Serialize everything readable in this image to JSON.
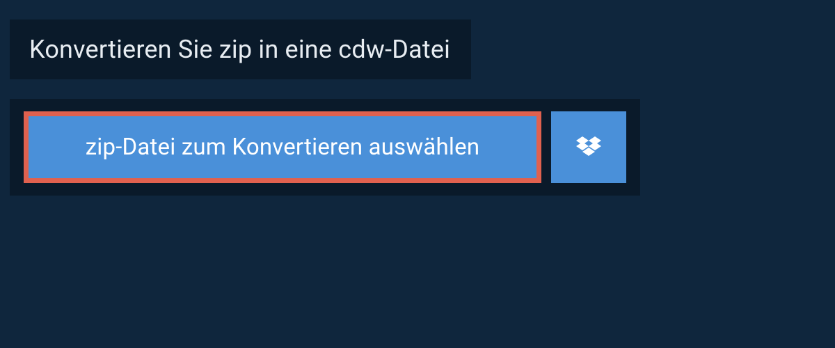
{
  "header": {
    "title": "Konvertieren Sie zip in eine cdw-Datei"
  },
  "buttons": {
    "select_file_label": "zip-Datei zum Konvertieren auswählen"
  },
  "colors": {
    "background": "#0f263d",
    "dark_panel": "#0a1a2a",
    "button_blue": "#4a90d9",
    "highlight_border": "#e0614f"
  }
}
